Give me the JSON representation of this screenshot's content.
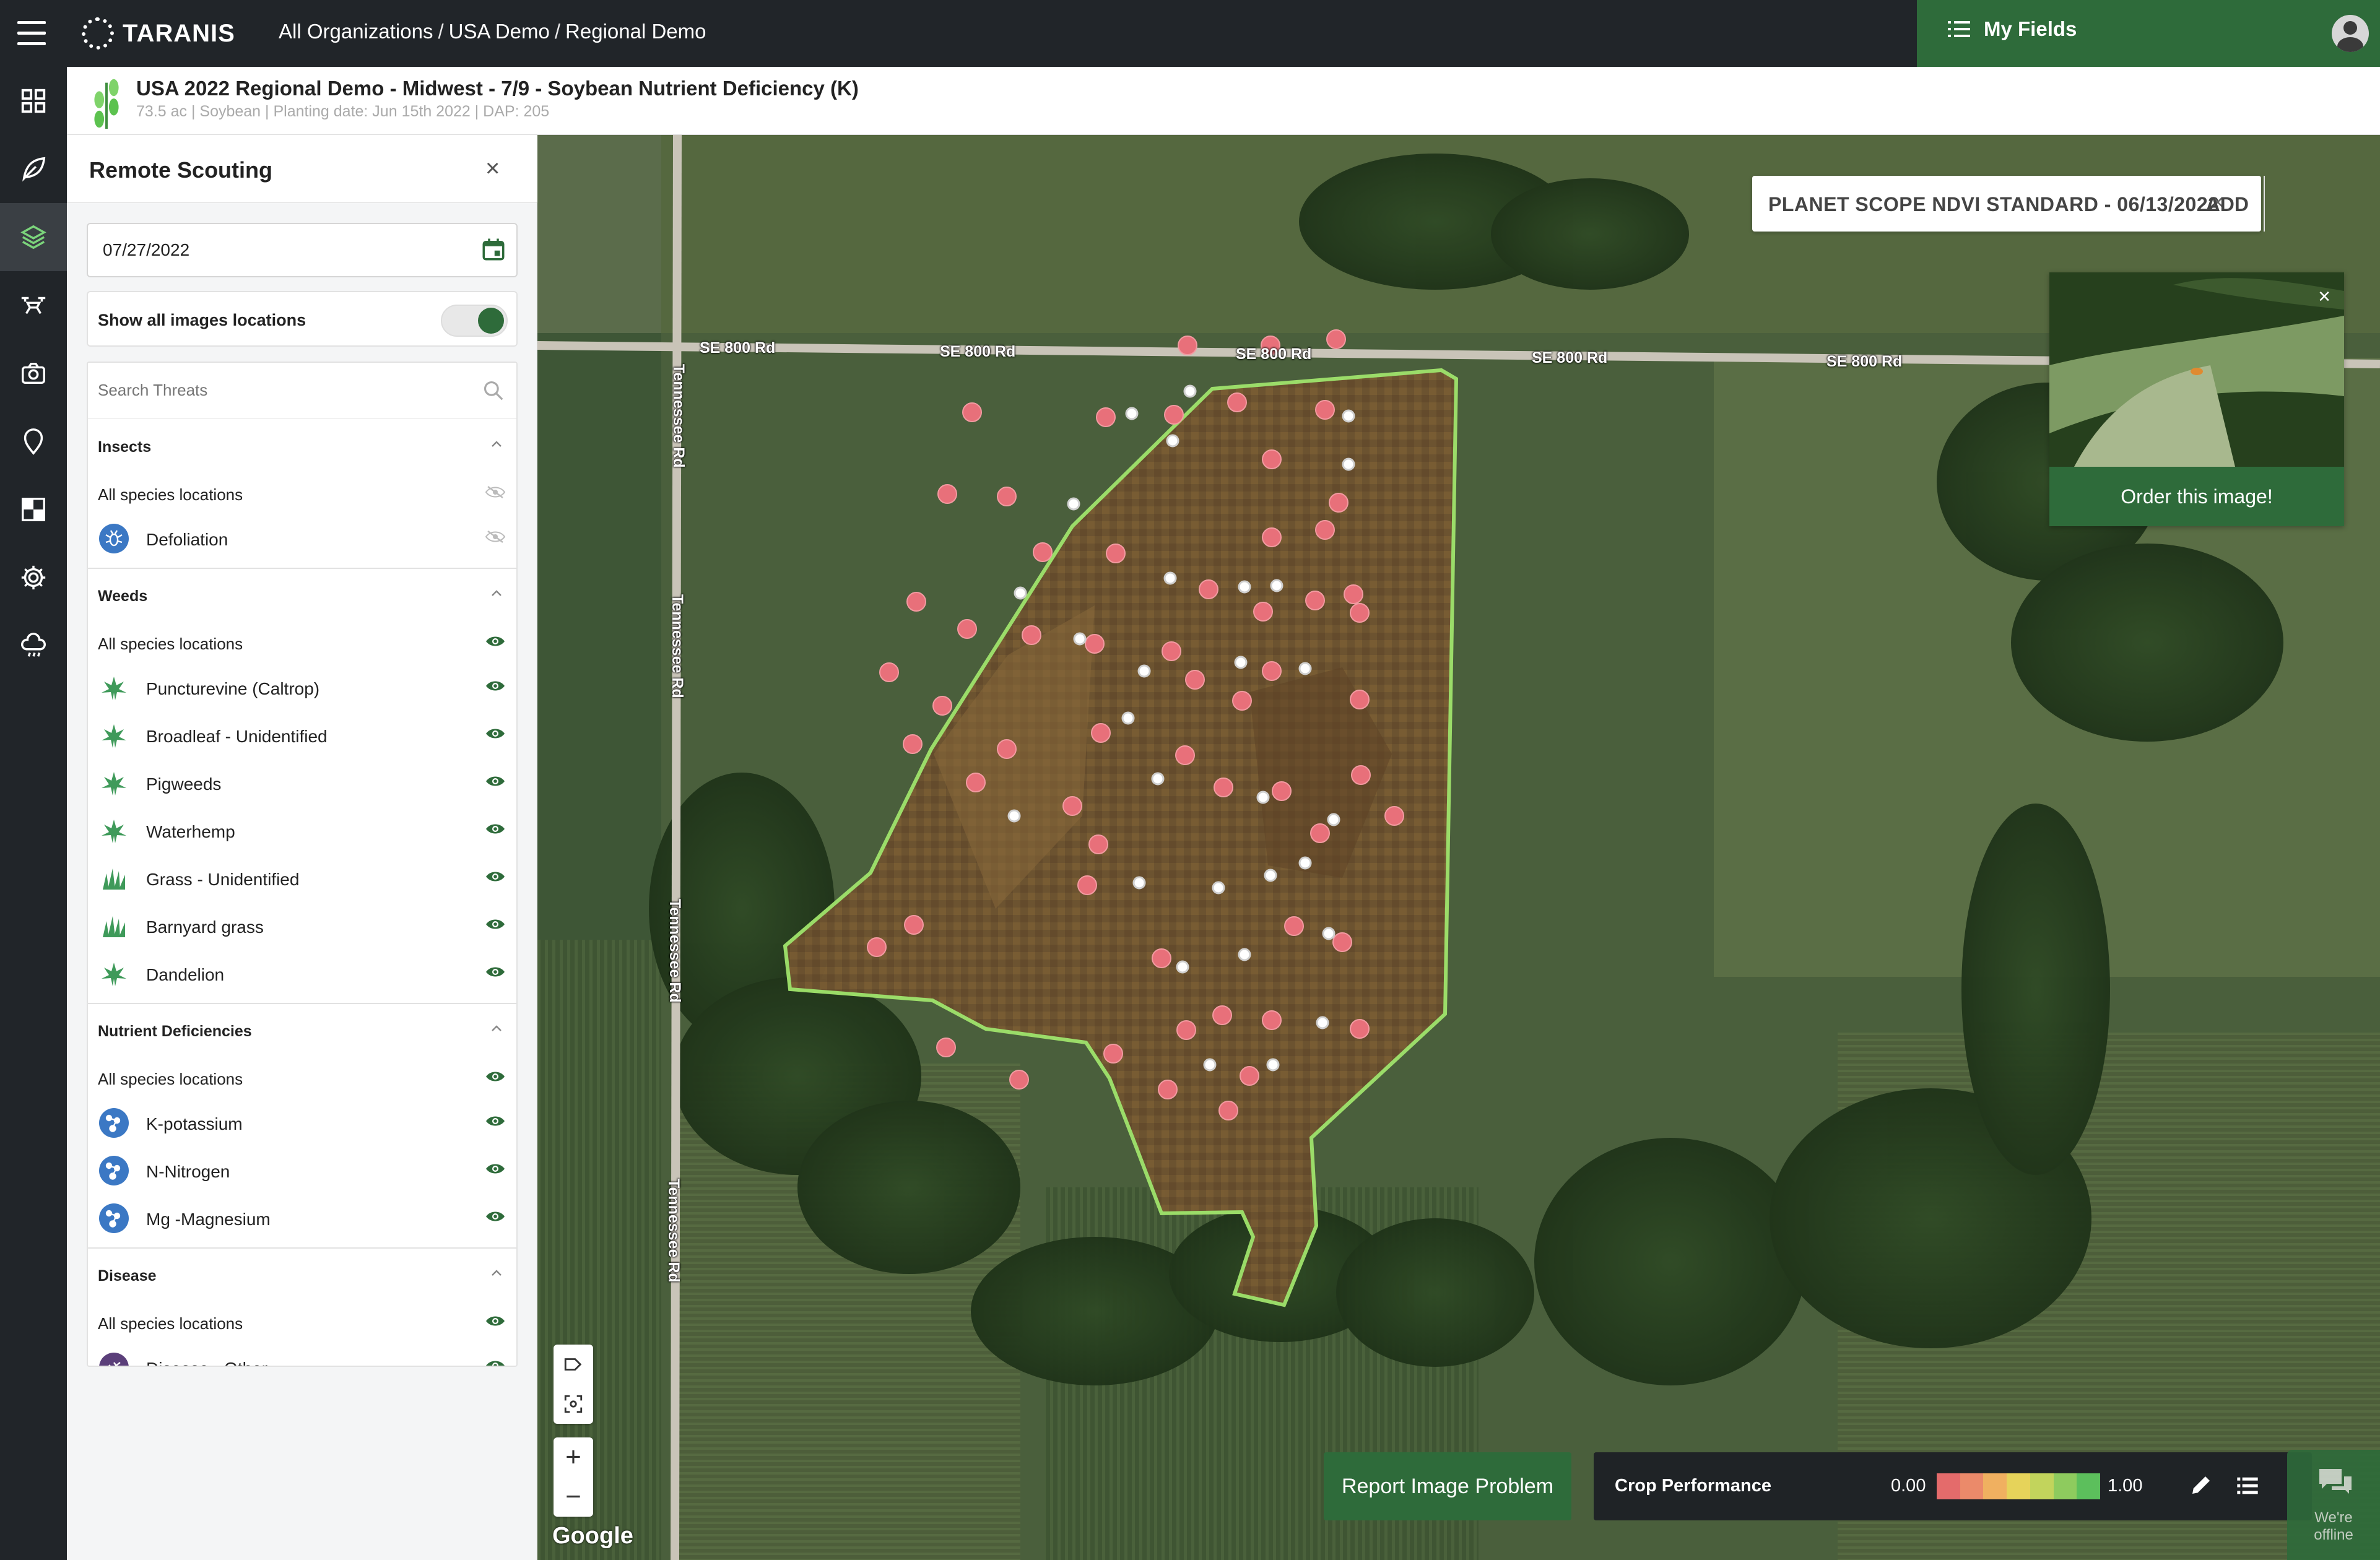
{
  "app": {
    "logo": "TARANIS"
  },
  "breadcrumb": {
    "items": [
      "All Organizations",
      "USA Demo",
      "Regional Demo"
    ],
    "separator": "/"
  },
  "header": {
    "my_fields": "My Fields"
  },
  "field": {
    "title": "USA 2022 Regional Demo - Midwest - 7/9 - Soybean Nutrient Deficiency (K)",
    "subtitle": "73.5 ac | Soybean | Planting date: Jun 15th 2022 | DAP: 205"
  },
  "rail": {
    "icons": [
      "grid-icon",
      "leaf-icon",
      "layers-icon",
      "drone-icon",
      "camera-icon",
      "location-pin-icon",
      "checker-icon",
      "settings-icon",
      "weather-icon"
    ],
    "active_index": 2
  },
  "panel": {
    "title": "Remote Scouting",
    "date": "07/27/2022",
    "toggle_label": "Show all images locations",
    "toggle_on": true,
    "search_placeholder": "Search Threats",
    "groups": [
      {
        "name": "Insects",
        "all_label": "All species locations",
        "visible": false,
        "items": [
          {
            "label": "Defoliation",
            "icon": "insect-icon",
            "visible": false
          }
        ]
      },
      {
        "name": "Weeds",
        "all_label": "All species locations",
        "visible": true,
        "items": [
          {
            "label": "Puncturevine (Caltrop)",
            "icon": "weed-icon",
            "visible": true
          },
          {
            "label": "Broadleaf - Unidentified",
            "icon": "weed-icon",
            "visible": true
          },
          {
            "label": "Pigweeds",
            "icon": "weed-icon",
            "visible": true
          },
          {
            "label": "Waterhemp",
            "icon": "weed-icon",
            "visible": true
          },
          {
            "label": "Grass - Unidentified",
            "icon": "grass-icon",
            "visible": true
          },
          {
            "label": "Barnyard grass",
            "icon": "grass-icon",
            "visible": true
          },
          {
            "label": "Dandelion",
            "icon": "weed-icon",
            "visible": true
          }
        ]
      },
      {
        "name": "Nutrient Deficiencies",
        "all_label": "All species locations",
        "visible": true,
        "items": [
          {
            "label": "K-potassium",
            "icon": "molecule-icon",
            "visible": true
          },
          {
            "label": "N-Nitrogen",
            "icon": "molecule-icon",
            "visible": true
          },
          {
            "label": "Mg -Magnesium",
            "icon": "molecule-icon",
            "visible": true
          }
        ]
      },
      {
        "name": "Disease",
        "all_label": "All species locations",
        "visible": true,
        "items": [
          {
            "label": "Disease - Other",
            "icon": "disease-icon",
            "visible": true
          }
        ]
      }
    ]
  },
  "map": {
    "layer_name": "PLANET SCOPE NDVI STANDARD - 06/13/2022",
    "layer_clear": "×",
    "add_label": "ADD",
    "order_label": "Order this image!",
    "order_close": "×",
    "roads": {
      "horizontal": "SE 800 Rd",
      "vertical": "Tennessee Rd"
    },
    "attribution": "Google",
    "zoom_in": "+",
    "zoom_out": "−",
    "report_label": "Report Image Problem",
    "legend_title": "Crop Performance",
    "legend_min": "0.00",
    "legend_max": "1.00",
    "legend_colors": [
      "#e46b6b",
      "#eb8a6a",
      "#f0b060",
      "#e6d35a",
      "#c2d45c",
      "#8ecb5e",
      "#5cbf5c"
    ],
    "offline_text": [
      "We're",
      "offline"
    ]
  }
}
